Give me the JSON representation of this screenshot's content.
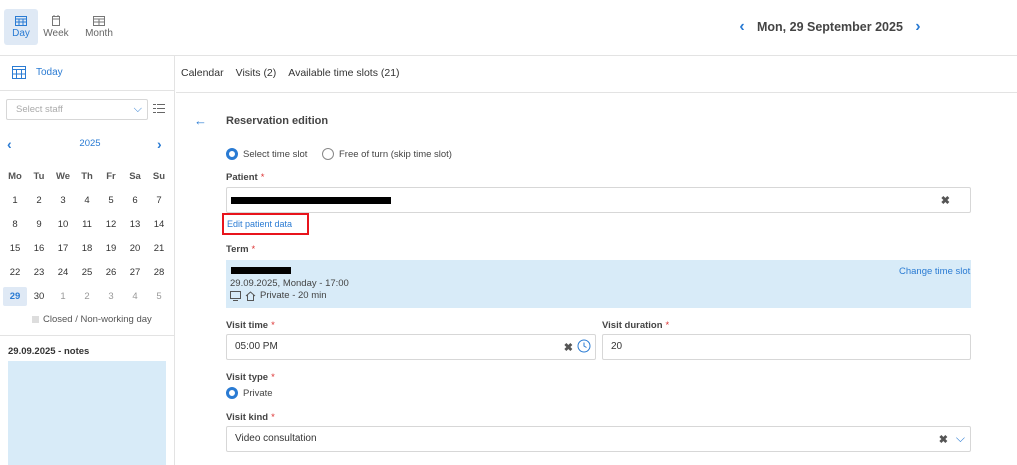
{
  "header": {
    "views": [
      {
        "label": "Day",
        "icon": "calendar-day-icon",
        "active": true
      },
      {
        "label": "Week",
        "icon": "calendar-week-icon",
        "active": false
      },
      {
        "label": "Month",
        "icon": "calendar-month-icon",
        "active": false
      }
    ],
    "date": "Mon, 29 September 2025",
    "prev_icon": "chevron-left-icon",
    "next_icon": "chevron-right-icon"
  },
  "sidebar": {
    "today_label": "Today",
    "staff_placeholder": "Select staff",
    "calendar": {
      "year": "2025",
      "weekdays": [
        "Mo",
        "Tu",
        "We",
        "Th",
        "Fr",
        "Sa",
        "Su"
      ],
      "weeks": [
        [
          "1",
          "2",
          "3",
          "4",
          "5",
          "6",
          "7"
        ],
        [
          "8",
          "9",
          "10",
          "11",
          "12",
          "13",
          "14"
        ],
        [
          "15",
          "16",
          "17",
          "18",
          "19",
          "20",
          "21"
        ],
        [
          "22",
          "23",
          "24",
          "25",
          "26",
          "27",
          "28"
        ],
        [
          "29",
          "30",
          "1",
          "2",
          "3",
          "4",
          "5"
        ]
      ],
      "selected": "29"
    },
    "legend": "Closed / Non-working day",
    "notes_title": "29.09.2025 - notes"
  },
  "tabs": [
    "Calendar",
    "Visits (2)",
    "Available time slots (21)"
  ],
  "form": {
    "title": "Reservation edition",
    "slot_options": [
      {
        "label": "Select time slot",
        "selected": true
      },
      {
        "label": "Free of turn (skip time slot)",
        "selected": false
      }
    ],
    "patient_label": "Patient",
    "required_mark": "*",
    "edit_patient_link": "Edit patient data",
    "term_label": "Term",
    "term_datetime": "29.09.2025, Monday - 17:00",
    "term_type": "Private - 20 min",
    "change_slot_link": "Change time slot",
    "visit_time_label": "Visit time",
    "visit_time_value": "05:00 PM",
    "visit_duration_label": "Visit duration",
    "visit_duration_value": "20",
    "visit_type_label": "Visit type",
    "visit_type_option": "Private",
    "visit_kind_label": "Visit kind",
    "visit_kind_value": "Video consultation",
    "clear_symbol": "✖"
  },
  "colors": {
    "accent": "#2a7bd3",
    "highlight_bg": "#d8ebf8",
    "annotation_red": "#e8141c"
  }
}
